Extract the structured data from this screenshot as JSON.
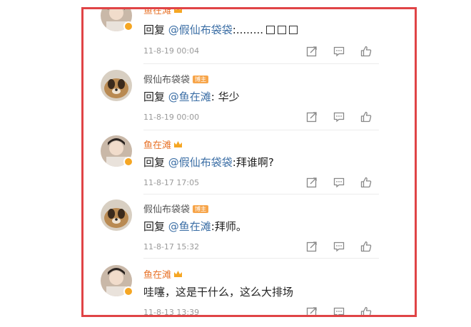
{
  "comments": [
    {
      "author": "鱼在滩",
      "reply_prefix": "回复 ",
      "mention": "@假仙布袋袋",
      "body": ":........",
      "time": "11-8-19 00:04",
      "boxes": 3
    },
    {
      "author": "假仙布袋袋",
      "author_tag": "博主",
      "reply_prefix": "回复 ",
      "mention": "@鱼在滩",
      "body": ": 华少",
      "time": "11-8-19 00:00"
    },
    {
      "author": "鱼在滩",
      "reply_prefix": "回复 ",
      "mention": "@假仙布袋袋",
      "body": ":拜谁啊?",
      "time": "11-8-17 17:05"
    },
    {
      "author": "假仙布袋袋",
      "author_tag": "博主",
      "reply_prefix": "回复 ",
      "mention": "@鱼在滩",
      "body": ":拜师。",
      "time": "11-8-17 15:32"
    },
    {
      "author": "鱼在滩",
      "body": "哇噻，这是干什么，这么大排场",
      "time": "11-8-13 13:39"
    }
  ],
  "colors": {
    "frame": "#e04446",
    "author_name": "#e8732a",
    "mention": "#3b6ea5",
    "tag_bg": "#f7a54a"
  },
  "icons": [
    "share-icon",
    "comment-icon",
    "like-icon",
    "verified-badge-icon",
    "crown-icon"
  ]
}
